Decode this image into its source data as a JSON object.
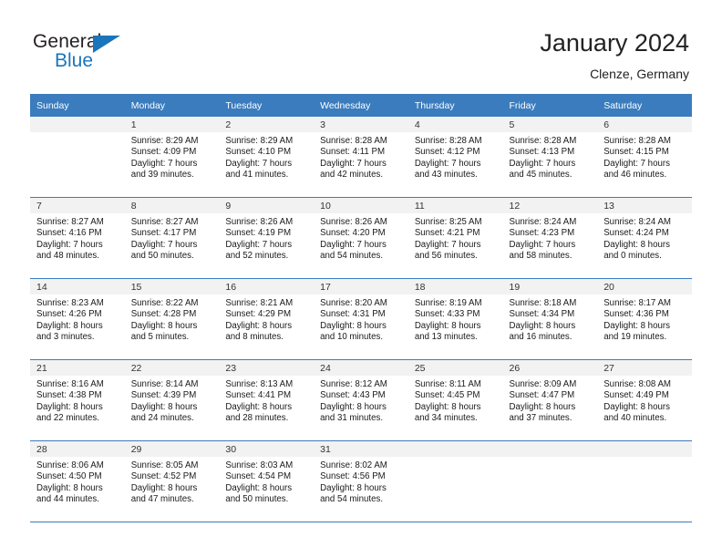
{
  "brand": {
    "name_top": "General",
    "name_bottom": "Blue",
    "triangle_color": "#1b75bb",
    "text_color": "#231f20"
  },
  "header": {
    "title": "January 2024",
    "subtitle": "Clenze, Germany"
  },
  "theme": {
    "header_row_bg": "#3a7cbe",
    "header_row_text": "#ffffff",
    "daynum_band_bg": "#f2f2f2",
    "cell_border": "#3a7cbe",
    "body_text": "#1a1a1a"
  },
  "weekday_headers": [
    "Sunday",
    "Monday",
    "Tuesday",
    "Wednesday",
    "Thursday",
    "Friday",
    "Saturday"
  ],
  "labels": {
    "sunrise_prefix": "Sunrise:",
    "sunset_prefix": "Sunset:",
    "daylight_prefix": "Daylight:"
  },
  "weeks": [
    [
      {
        "day": "",
        "sunrise": "",
        "sunset": "",
        "daylight_line1": "",
        "daylight_line2": ""
      },
      {
        "day": "1",
        "sunrise": "Sunrise: 8:29 AM",
        "sunset": "Sunset: 4:09 PM",
        "daylight_line1": "Daylight: 7 hours",
        "daylight_line2": "and 39 minutes."
      },
      {
        "day": "2",
        "sunrise": "Sunrise: 8:29 AM",
        "sunset": "Sunset: 4:10 PM",
        "daylight_line1": "Daylight: 7 hours",
        "daylight_line2": "and 41 minutes."
      },
      {
        "day": "3",
        "sunrise": "Sunrise: 8:28 AM",
        "sunset": "Sunset: 4:11 PM",
        "daylight_line1": "Daylight: 7 hours",
        "daylight_line2": "and 42 minutes."
      },
      {
        "day": "4",
        "sunrise": "Sunrise: 8:28 AM",
        "sunset": "Sunset: 4:12 PM",
        "daylight_line1": "Daylight: 7 hours",
        "daylight_line2": "and 43 minutes."
      },
      {
        "day": "5",
        "sunrise": "Sunrise: 8:28 AM",
        "sunset": "Sunset: 4:13 PM",
        "daylight_line1": "Daylight: 7 hours",
        "daylight_line2": "and 45 minutes."
      },
      {
        "day": "6",
        "sunrise": "Sunrise: 8:28 AM",
        "sunset": "Sunset: 4:15 PM",
        "daylight_line1": "Daylight: 7 hours",
        "daylight_line2": "and 46 minutes."
      }
    ],
    [
      {
        "day": "7",
        "sunrise": "Sunrise: 8:27 AM",
        "sunset": "Sunset: 4:16 PM",
        "daylight_line1": "Daylight: 7 hours",
        "daylight_line2": "and 48 minutes."
      },
      {
        "day": "8",
        "sunrise": "Sunrise: 8:27 AM",
        "sunset": "Sunset: 4:17 PM",
        "daylight_line1": "Daylight: 7 hours",
        "daylight_line2": "and 50 minutes."
      },
      {
        "day": "9",
        "sunrise": "Sunrise: 8:26 AM",
        "sunset": "Sunset: 4:19 PM",
        "daylight_line1": "Daylight: 7 hours",
        "daylight_line2": "and 52 minutes."
      },
      {
        "day": "10",
        "sunrise": "Sunrise: 8:26 AM",
        "sunset": "Sunset: 4:20 PM",
        "daylight_line1": "Daylight: 7 hours",
        "daylight_line2": "and 54 minutes."
      },
      {
        "day": "11",
        "sunrise": "Sunrise: 8:25 AM",
        "sunset": "Sunset: 4:21 PM",
        "daylight_line1": "Daylight: 7 hours",
        "daylight_line2": "and 56 minutes."
      },
      {
        "day": "12",
        "sunrise": "Sunrise: 8:24 AM",
        "sunset": "Sunset: 4:23 PM",
        "daylight_line1": "Daylight: 7 hours",
        "daylight_line2": "and 58 minutes."
      },
      {
        "day": "13",
        "sunrise": "Sunrise: 8:24 AM",
        "sunset": "Sunset: 4:24 PM",
        "daylight_line1": "Daylight: 8 hours",
        "daylight_line2": "and 0 minutes."
      }
    ],
    [
      {
        "day": "14",
        "sunrise": "Sunrise: 8:23 AM",
        "sunset": "Sunset: 4:26 PM",
        "daylight_line1": "Daylight: 8 hours",
        "daylight_line2": "and 3 minutes."
      },
      {
        "day": "15",
        "sunrise": "Sunrise: 8:22 AM",
        "sunset": "Sunset: 4:28 PM",
        "daylight_line1": "Daylight: 8 hours",
        "daylight_line2": "and 5 minutes."
      },
      {
        "day": "16",
        "sunrise": "Sunrise: 8:21 AM",
        "sunset": "Sunset: 4:29 PM",
        "daylight_line1": "Daylight: 8 hours",
        "daylight_line2": "and 8 minutes."
      },
      {
        "day": "17",
        "sunrise": "Sunrise: 8:20 AM",
        "sunset": "Sunset: 4:31 PM",
        "daylight_line1": "Daylight: 8 hours",
        "daylight_line2": "and 10 minutes."
      },
      {
        "day": "18",
        "sunrise": "Sunrise: 8:19 AM",
        "sunset": "Sunset: 4:33 PM",
        "daylight_line1": "Daylight: 8 hours",
        "daylight_line2": "and 13 minutes."
      },
      {
        "day": "19",
        "sunrise": "Sunrise: 8:18 AM",
        "sunset": "Sunset: 4:34 PM",
        "daylight_line1": "Daylight: 8 hours",
        "daylight_line2": "and 16 minutes."
      },
      {
        "day": "20",
        "sunrise": "Sunrise: 8:17 AM",
        "sunset": "Sunset: 4:36 PM",
        "daylight_line1": "Daylight: 8 hours",
        "daylight_line2": "and 19 minutes."
      }
    ],
    [
      {
        "day": "21",
        "sunrise": "Sunrise: 8:16 AM",
        "sunset": "Sunset: 4:38 PM",
        "daylight_line1": "Daylight: 8 hours",
        "daylight_line2": "and 22 minutes."
      },
      {
        "day": "22",
        "sunrise": "Sunrise: 8:14 AM",
        "sunset": "Sunset: 4:39 PM",
        "daylight_line1": "Daylight: 8 hours",
        "daylight_line2": "and 24 minutes."
      },
      {
        "day": "23",
        "sunrise": "Sunrise: 8:13 AM",
        "sunset": "Sunset: 4:41 PM",
        "daylight_line1": "Daylight: 8 hours",
        "daylight_line2": "and 28 minutes."
      },
      {
        "day": "24",
        "sunrise": "Sunrise: 8:12 AM",
        "sunset": "Sunset: 4:43 PM",
        "daylight_line1": "Daylight: 8 hours",
        "daylight_line2": "and 31 minutes."
      },
      {
        "day": "25",
        "sunrise": "Sunrise: 8:11 AM",
        "sunset": "Sunset: 4:45 PM",
        "daylight_line1": "Daylight: 8 hours",
        "daylight_line2": "and 34 minutes."
      },
      {
        "day": "26",
        "sunrise": "Sunrise: 8:09 AM",
        "sunset": "Sunset: 4:47 PM",
        "daylight_line1": "Daylight: 8 hours",
        "daylight_line2": "and 37 minutes."
      },
      {
        "day": "27",
        "sunrise": "Sunrise: 8:08 AM",
        "sunset": "Sunset: 4:49 PM",
        "daylight_line1": "Daylight: 8 hours",
        "daylight_line2": "and 40 minutes."
      }
    ],
    [
      {
        "day": "28",
        "sunrise": "Sunrise: 8:06 AM",
        "sunset": "Sunset: 4:50 PM",
        "daylight_line1": "Daylight: 8 hours",
        "daylight_line2": "and 44 minutes."
      },
      {
        "day": "29",
        "sunrise": "Sunrise: 8:05 AM",
        "sunset": "Sunset: 4:52 PM",
        "daylight_line1": "Daylight: 8 hours",
        "daylight_line2": "and 47 minutes."
      },
      {
        "day": "30",
        "sunrise": "Sunrise: 8:03 AM",
        "sunset": "Sunset: 4:54 PM",
        "daylight_line1": "Daylight: 8 hours",
        "daylight_line2": "and 50 minutes."
      },
      {
        "day": "31",
        "sunrise": "Sunrise: 8:02 AM",
        "sunset": "Sunset: 4:56 PM",
        "daylight_line1": "Daylight: 8 hours",
        "daylight_line2": "and 54 minutes."
      },
      {
        "day": "",
        "sunrise": "",
        "sunset": "",
        "daylight_line1": "",
        "daylight_line2": ""
      },
      {
        "day": "",
        "sunrise": "",
        "sunset": "",
        "daylight_line1": "",
        "daylight_line2": ""
      },
      {
        "day": "",
        "sunrise": "",
        "sunset": "",
        "daylight_line1": "",
        "daylight_line2": ""
      }
    ]
  ]
}
